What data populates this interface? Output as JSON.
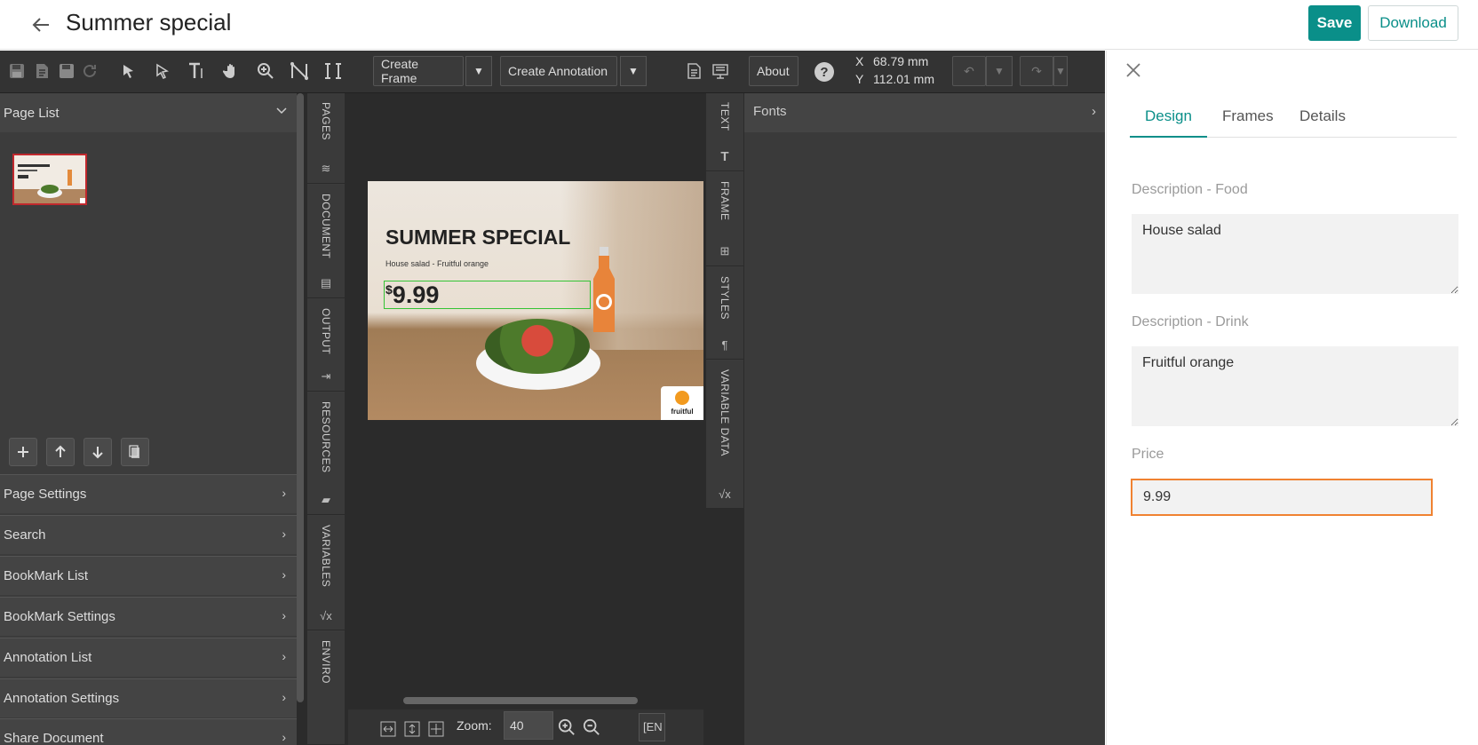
{
  "header": {
    "title": "Summer special",
    "save_label": "Save",
    "download_label": "Download"
  },
  "toolbar": {
    "create_frame_label": "Create Frame",
    "create_annotation_label": "Create Annotation",
    "about_label": "About",
    "coord_x_label": "X",
    "coord_x_value": "68.79 mm",
    "coord_y_label": "Y",
    "coord_y_value": "112.01 mm"
  },
  "left_panel": {
    "page_list_label": "Page List",
    "accordion": [
      {
        "label": "Page Settings"
      },
      {
        "label": "Search"
      },
      {
        "label": "BookMark List"
      },
      {
        "label": "BookMark Settings"
      },
      {
        "label": "Annotation List"
      },
      {
        "label": "Annotation Settings"
      },
      {
        "label": "Share Document"
      }
    ]
  },
  "left_tabs": [
    {
      "label": "PAGES"
    },
    {
      "label": "DOCUMENT"
    },
    {
      "label": "OUTPUT"
    },
    {
      "label": "RESOURCES"
    },
    {
      "label": "VARIABLES"
    },
    {
      "label": "ENVIRO"
    }
  ],
  "right_tabs": [
    {
      "label": "TEXT"
    },
    {
      "label": "FRAME"
    },
    {
      "label": "STYLES"
    },
    {
      "label": "VARIABLE DATA"
    }
  ],
  "design": {
    "headline": "SUMMER SPECIAL",
    "subline": "House salad - Fruitful orange",
    "currency": "$",
    "price": "9.99",
    "logo_text": "fruitful"
  },
  "zoom": {
    "label": "Zoom:",
    "value": "40",
    "lang": "[EN"
  },
  "fonts_panel": {
    "label": "Fonts"
  },
  "properties": {
    "tabs": [
      {
        "label": "Design"
      },
      {
        "label": "Frames"
      },
      {
        "label": "Details"
      }
    ],
    "food_label": "Description - Food",
    "food_value": "House salad",
    "drink_label": "Description - Drink",
    "drink_value": "Fruitful orange",
    "price_label": "Price",
    "price_value": "9.99"
  },
  "colors": {
    "accent": "#0a8f89",
    "focus_border": "#f08231",
    "frame_selection": "#35c435"
  }
}
